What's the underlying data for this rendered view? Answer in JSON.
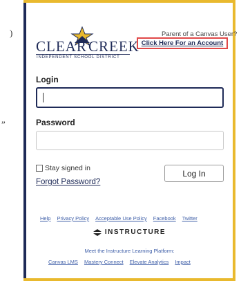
{
  "stray_marks": [
    ")",
    "”"
  ],
  "logo": {
    "word_left": "CLEAR",
    "word_right": "CREEK",
    "subtitle": "INDEPENDENT SCHOOL DISTRICT"
  },
  "parent": {
    "question": "Parent of a Canvas User?",
    "link": "Click Here For an Account"
  },
  "form": {
    "login_label": "Login",
    "login_value": "",
    "password_label": "Password",
    "password_value": "",
    "stay_signed_in": "Stay signed in",
    "forgot_password": "Forgot Password?",
    "login_button": "Log In"
  },
  "footer": {
    "links": [
      "Help",
      "Privacy Policy",
      "Acceptable Use Policy",
      "Facebook",
      "Twitter"
    ],
    "brand": "INSTRUCTURE",
    "tagline": "Meet the Instructure Learning Platform:",
    "products": [
      "Canvas LMS",
      "Mastery Connect",
      "Elevate Analytics",
      "Impact"
    ]
  },
  "colors": {
    "navy": "#1e2a57",
    "gold": "#e9b92e",
    "highlight_box": "#e04848",
    "link_blue": "#3f5fa8"
  }
}
